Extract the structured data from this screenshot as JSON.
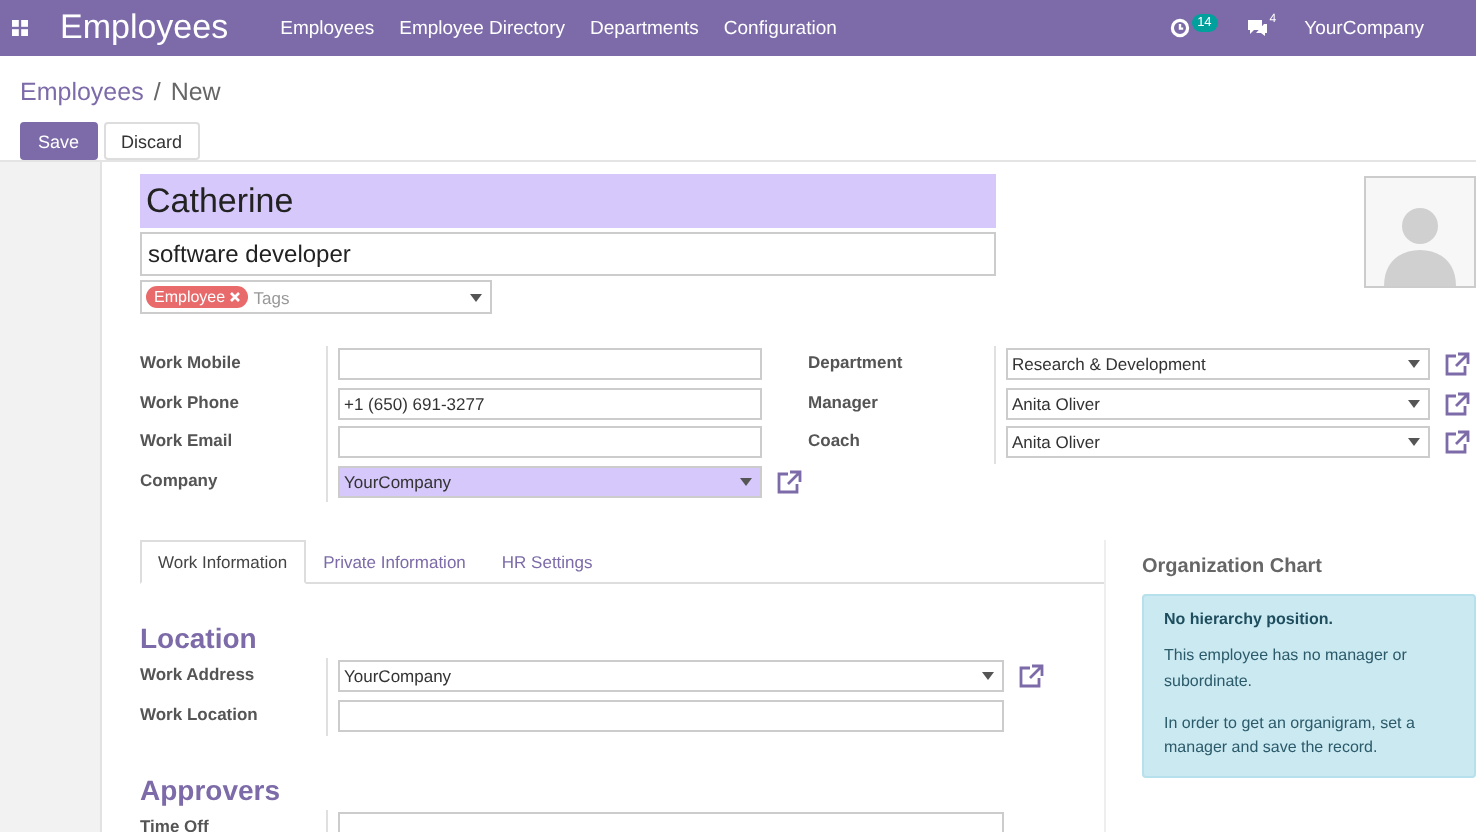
{
  "navbar": {
    "app_name": "Employees",
    "menu": [
      "Employees",
      "Employee Directory",
      "Departments",
      "Configuration"
    ],
    "activity_count": "14",
    "message_count": "4",
    "company": "YourCompany"
  },
  "breadcrumb": {
    "parent": "Employees",
    "separator": "/",
    "current": "New"
  },
  "buttons": [
    {
      "label": "Save",
      "kind": "primary"
    },
    {
      "label": "Discard",
      "kind": "secondary"
    }
  ],
  "form": {
    "name": "Catherine",
    "job_title": "software developer",
    "tags": [
      {
        "label": "Employee",
        "color": "#e86a6a"
      }
    ],
    "tags_placeholder": "Tags",
    "left_fields": [
      {
        "label": "Work Mobile",
        "kind": "text",
        "required": false,
        "link": false
      },
      {
        "label": "Work Phone",
        "value": "+1 (650) 691-3277",
        "kind": "text",
        "required": false,
        "link": false
      },
      {
        "label": "Work Email",
        "kind": "text",
        "required": false,
        "link": false
      },
      {
        "label": "Company",
        "value": "YourCompany",
        "kind": "select",
        "required": true,
        "link": true
      }
    ],
    "right_fields": [
      {
        "label": "Department",
        "value": "Research & Development",
        "kind": "select",
        "required": false,
        "link": true
      },
      {
        "label": "Manager",
        "value": "Anita Oliver",
        "kind": "select",
        "required": false,
        "link": true
      },
      {
        "label": "Coach",
        "value": "Anita Oliver",
        "kind": "select",
        "required": false,
        "link": true
      }
    ]
  },
  "tabs": [
    {
      "label": "Work Information",
      "selected": true
    },
    {
      "label": "Private Information",
      "selected": false
    },
    {
      "label": "HR Settings",
      "selected": false
    }
  ],
  "sections": [
    {
      "title": "Location",
      "fields": [
        {
          "label": "Work Address",
          "value": "YourCompany",
          "kind": "select",
          "required": false,
          "link": true
        },
        {
          "label": "Work Location",
          "kind": "text",
          "required": false,
          "link": false
        }
      ]
    },
    {
      "title": "Approvers",
      "fields": [
        {
          "label": "Time Off",
          "kind": "text",
          "required": false,
          "link": false
        }
      ]
    }
  ],
  "org_chart": {
    "title": "Organization Chart",
    "heading": "No hierarchy position.",
    "paragraphs": [
      "This employee has no manager or subordinate.",
      "In order to get an organigram, set a manager and save the record."
    ]
  }
}
